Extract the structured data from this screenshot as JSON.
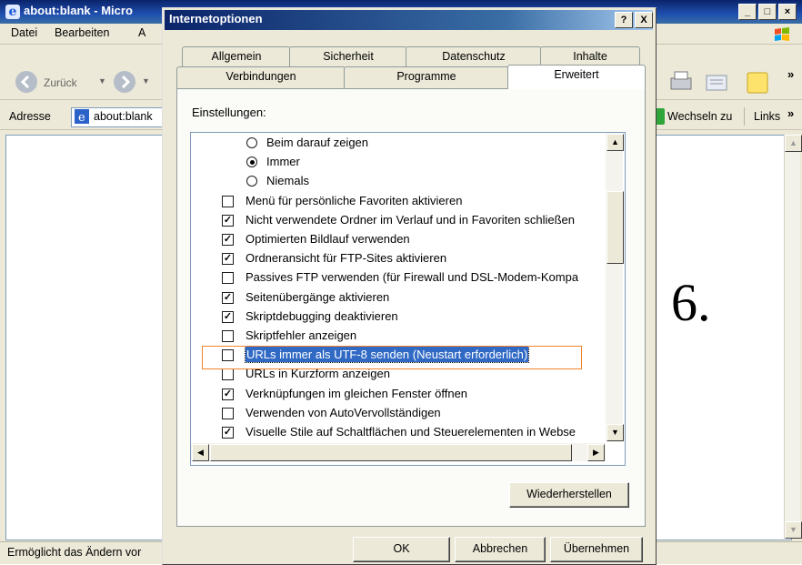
{
  "browser": {
    "title": "about:blank - Micro",
    "menu": [
      "Datei",
      "Bearbeiten",
      "A"
    ],
    "back_label": "Zurück",
    "address_label": "Adresse",
    "address_value": "about:blank",
    "go_label": "Wechseln zu",
    "links_label": "Links",
    "status_text": "Ermöglicht das Ändern vor"
  },
  "dialog": {
    "title": "Internetoptionen",
    "help_button": "?",
    "close_button": "X",
    "tabs_row1": [
      "Allgemein",
      "Sicherheit",
      "Datenschutz",
      "Inhalte"
    ],
    "tabs_row2": [
      "Verbindungen",
      "Programme",
      "Erweitert"
    ],
    "active_tab": "Erweitert",
    "settings_label": "Einstellungen:",
    "settings": [
      {
        "type": "radio",
        "checked": false,
        "label": "Beim darauf zeigen"
      },
      {
        "type": "radio",
        "checked": true,
        "label": "Immer"
      },
      {
        "type": "radio",
        "checked": false,
        "label": "Niemals"
      },
      {
        "type": "checkbox",
        "checked": false,
        "label": "Menü für persönliche Favoriten aktivieren"
      },
      {
        "type": "checkbox",
        "checked": true,
        "label": "Nicht verwendete Ordner im Verlauf und in Favoriten schließen"
      },
      {
        "type": "checkbox",
        "checked": true,
        "label": "Optimierten Bildlauf verwenden"
      },
      {
        "type": "checkbox",
        "checked": true,
        "label": "Ordneransicht für FTP-Sites aktivieren"
      },
      {
        "type": "checkbox",
        "checked": false,
        "label": "Passives FTP verwenden (für Firewall und DSL-Modem-Kompa"
      },
      {
        "type": "checkbox",
        "checked": true,
        "label": "Seitenübergänge aktivieren"
      },
      {
        "type": "checkbox",
        "checked": true,
        "label": "Skriptdebugging deaktivieren"
      },
      {
        "type": "checkbox",
        "checked": false,
        "label": "Skriptfehler anzeigen"
      },
      {
        "type": "checkbox",
        "checked": false,
        "label": "URLs immer als UTF-8 senden (Neustart erforderlich)",
        "highlighted": true
      },
      {
        "type": "checkbox",
        "checked": false,
        "label": "URLs in Kurzform anzeigen"
      },
      {
        "type": "checkbox",
        "checked": true,
        "label": "Verknüpfungen im gleichen Fenster öffnen"
      },
      {
        "type": "checkbox",
        "checked": false,
        "label": "Verwenden von AutoVervollständigen"
      },
      {
        "type": "checkbox",
        "checked": true,
        "label": "Visuelle Stile auf Schaltflächen und Steuerelementen in Webse"
      }
    ],
    "restore_button": "Wiederherstellen",
    "ok_button": "OK",
    "cancel_button": "Abbrechen",
    "apply_button": "Übernehmen"
  },
  "step_marker": "6.",
  "colors": {
    "highlight_orange": "#f0832c",
    "selection_blue": "#316ac5",
    "titlebar_blue": "#0a246a"
  }
}
